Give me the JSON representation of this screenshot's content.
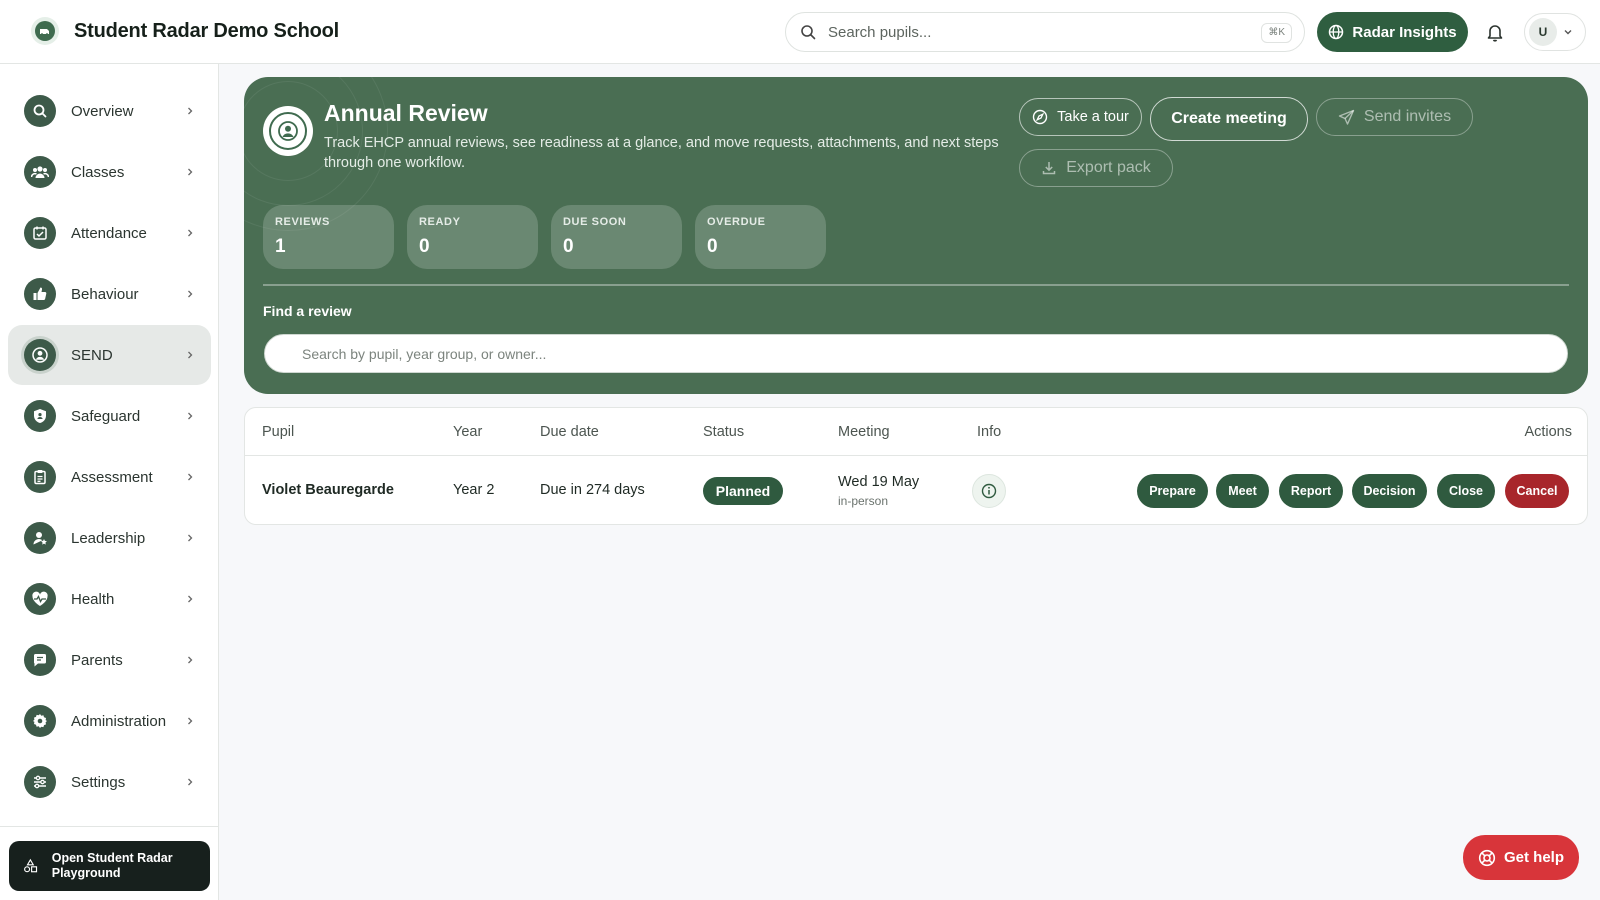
{
  "header": {
    "app_title": "Student Radar Demo School",
    "search_placeholder": "Search pupils...",
    "search_shortcut": "⌘K",
    "insights_label": "Radar Insights",
    "user_initial": "U"
  },
  "sidebar": {
    "items": [
      {
        "label": "Overview",
        "icon": "search-icon"
      },
      {
        "label": "Classes",
        "icon": "users-icon"
      },
      {
        "label": "Attendance",
        "icon": "calendar-check-icon"
      },
      {
        "label": "Behaviour",
        "icon": "thumbs-up-icon"
      },
      {
        "label": "SEND",
        "icon": "user-circle-icon",
        "active": true
      },
      {
        "label": "Safeguard",
        "icon": "shield-icon"
      },
      {
        "label": "Assessment",
        "icon": "clipboard-icon"
      },
      {
        "label": "Leadership",
        "icon": "user-star-icon"
      },
      {
        "label": "Health",
        "icon": "heart-pulse-icon"
      },
      {
        "label": "Parents",
        "icon": "chat-icon"
      },
      {
        "label": "Administration",
        "icon": "gear-icon"
      },
      {
        "label": "Settings",
        "icon": "sliders-icon"
      }
    ],
    "playground_label": "Open Student Radar Playground"
  },
  "hero": {
    "title": "Annual Review",
    "description": "Track EHCP annual reviews, see readiness at a glance, and move requests, attachments, and next steps through one workflow.",
    "buttons": {
      "tour": "Take a tour",
      "create_meeting": "Create meeting",
      "send_invites": "Send invites",
      "export_pack": "Export pack"
    },
    "stats": [
      {
        "label": "REVIEWS",
        "value": "1"
      },
      {
        "label": "READY",
        "value": "0"
      },
      {
        "label": "DUE SOON",
        "value": "0"
      },
      {
        "label": "OVERDUE",
        "value": "0"
      }
    ],
    "find_label": "Find a review",
    "find_placeholder": "Search by pupil, year group, or owner..."
  },
  "table": {
    "columns": [
      "Pupil",
      "Year",
      "Due date",
      "Status",
      "Meeting",
      "Info",
      "Actions"
    ],
    "rows": [
      {
        "pupil": "Violet Beauregarde",
        "year": "Year 2",
        "due": "Due in 274 days",
        "status": "Planned",
        "meeting_date": "Wed 19 May",
        "meeting_mode": "in-person",
        "actions": [
          "Prepare",
          "Meet",
          "Report",
          "Decision",
          "Close",
          "Cancel"
        ]
      }
    ]
  },
  "help_label": "Get help",
  "colors": {
    "brand": "#2f5e40",
    "hero_bg": "#4a6e53",
    "danger": "#d8353a",
    "cancel": "#a8262b"
  }
}
